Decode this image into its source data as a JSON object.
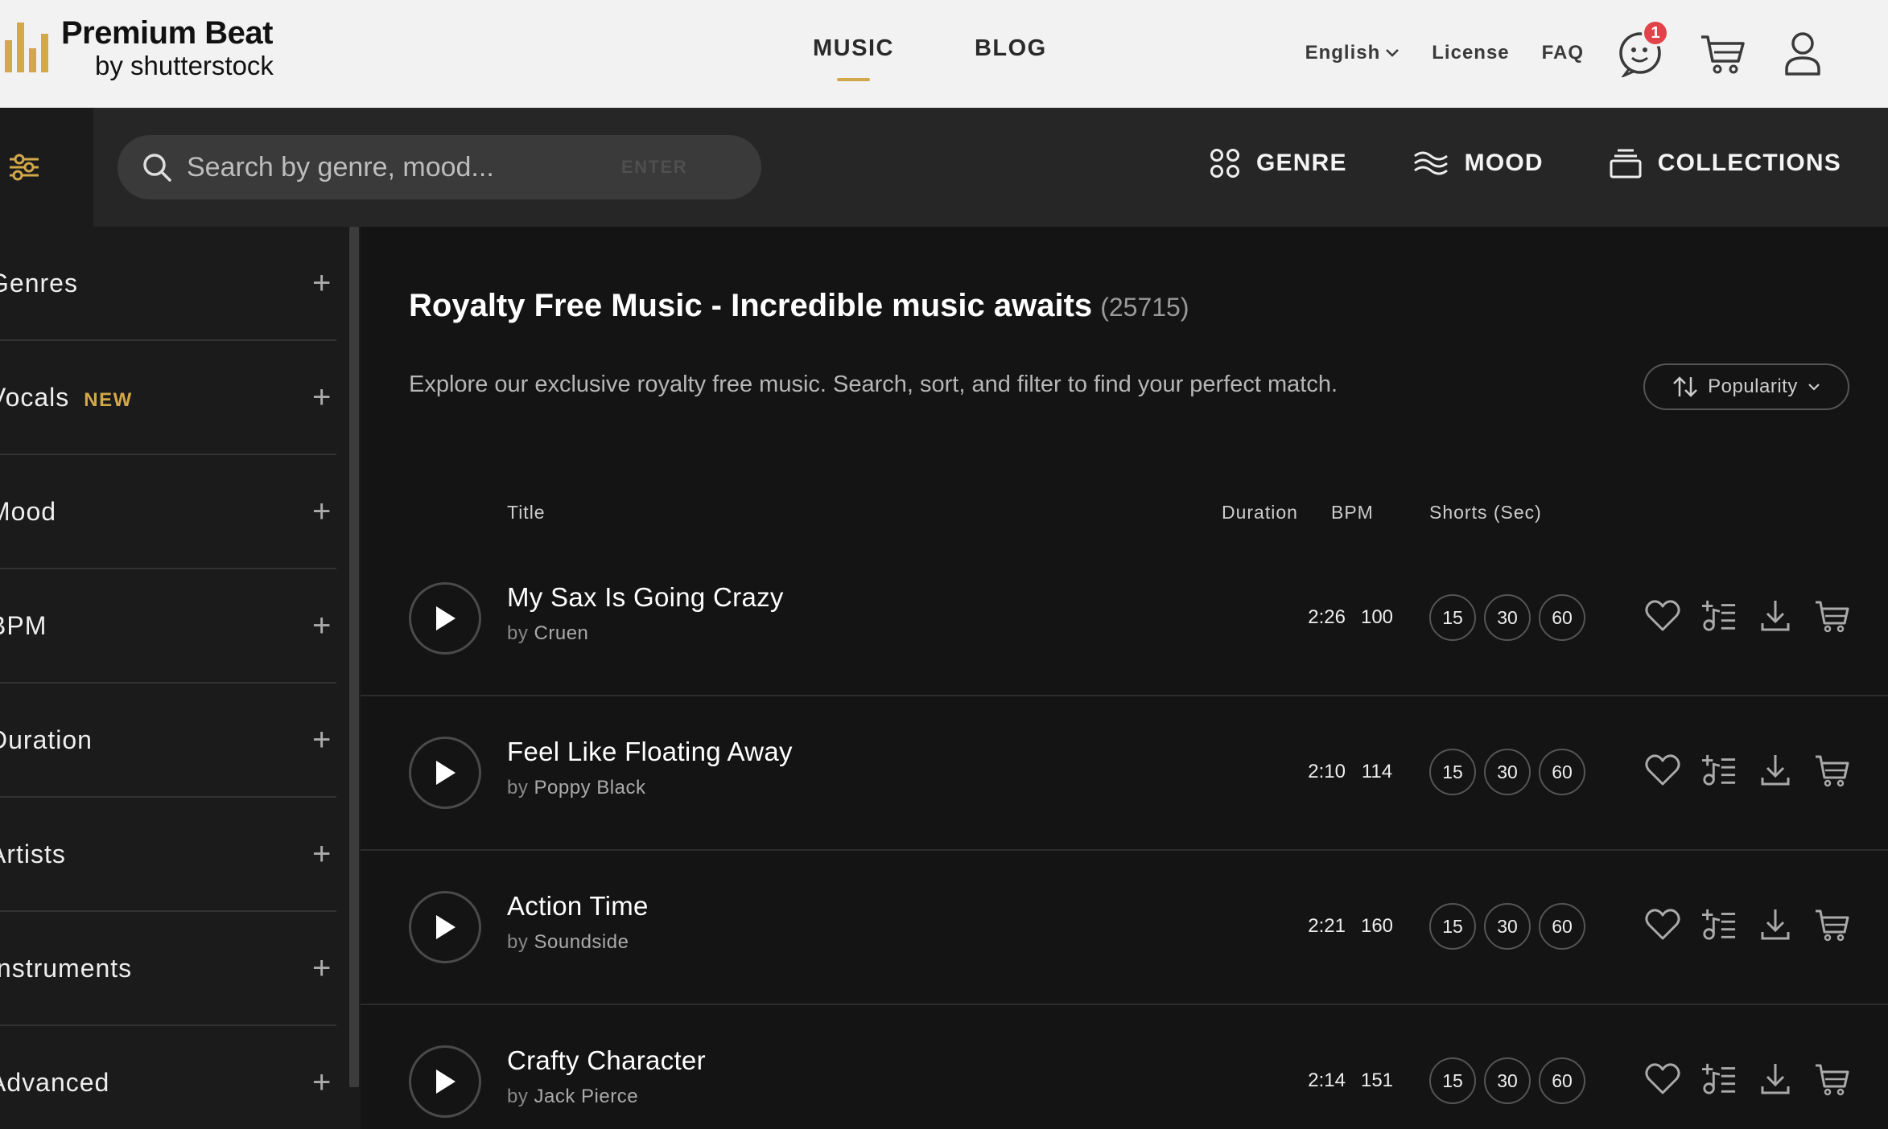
{
  "brand": {
    "name": "Premium Beat",
    "sub": "by shutterstock",
    "accent": "#d3a84a"
  },
  "topnav": [
    {
      "label": "MUSIC",
      "active": true
    },
    {
      "label": "BLOG",
      "active": false
    }
  ],
  "header": {
    "language": "English",
    "license": "License",
    "faq": "FAQ",
    "notifications": "1"
  },
  "search": {
    "placeholder": "Search by genre, mood...",
    "enter_hint": "ENTER"
  },
  "filters": {
    "genre": "GENRE",
    "mood": "MOOD",
    "collections": "COLLECTIONS"
  },
  "sidebar": {
    "items": [
      {
        "label": "Genres"
      },
      {
        "label": "Vocals",
        "badge": "NEW"
      },
      {
        "label": "Mood"
      },
      {
        "label": "BPM"
      },
      {
        "label": "Duration"
      },
      {
        "label": "Artists"
      },
      {
        "label": "Instruments"
      },
      {
        "label": "Advanced"
      }
    ]
  },
  "main": {
    "title": "Royalty Free Music - Incredible music awaits",
    "count": "(25715)",
    "description": "Explore our exclusive royalty free music. Search, sort, and filter to find your perfect match.",
    "sort_label": "Popularity",
    "columns": {
      "title": "Title",
      "duration": "Duration",
      "bpm": "BPM",
      "shorts": "Shorts (Sec)"
    }
  },
  "tracks": [
    {
      "title": "My Sax Is Going Crazy",
      "by": "by",
      "artist": "Cruen",
      "duration": "2:26",
      "bpm": "100",
      "shorts": [
        "15",
        "30",
        "60"
      ]
    },
    {
      "title": "Feel Like Floating Away",
      "by": "by",
      "artist": "Poppy Black",
      "duration": "2:10",
      "bpm": "114",
      "shorts": [
        "15",
        "30",
        "60"
      ]
    },
    {
      "title": "Action Time",
      "by": "by",
      "artist": "Soundside",
      "duration": "2:21",
      "bpm": "160",
      "shorts": [
        "15",
        "30",
        "60"
      ]
    },
    {
      "title": "Crafty Character",
      "by": "by",
      "artist": "Jack Pierce",
      "duration": "2:14",
      "bpm": "151",
      "shorts": [
        "15",
        "30",
        "60"
      ]
    }
  ]
}
